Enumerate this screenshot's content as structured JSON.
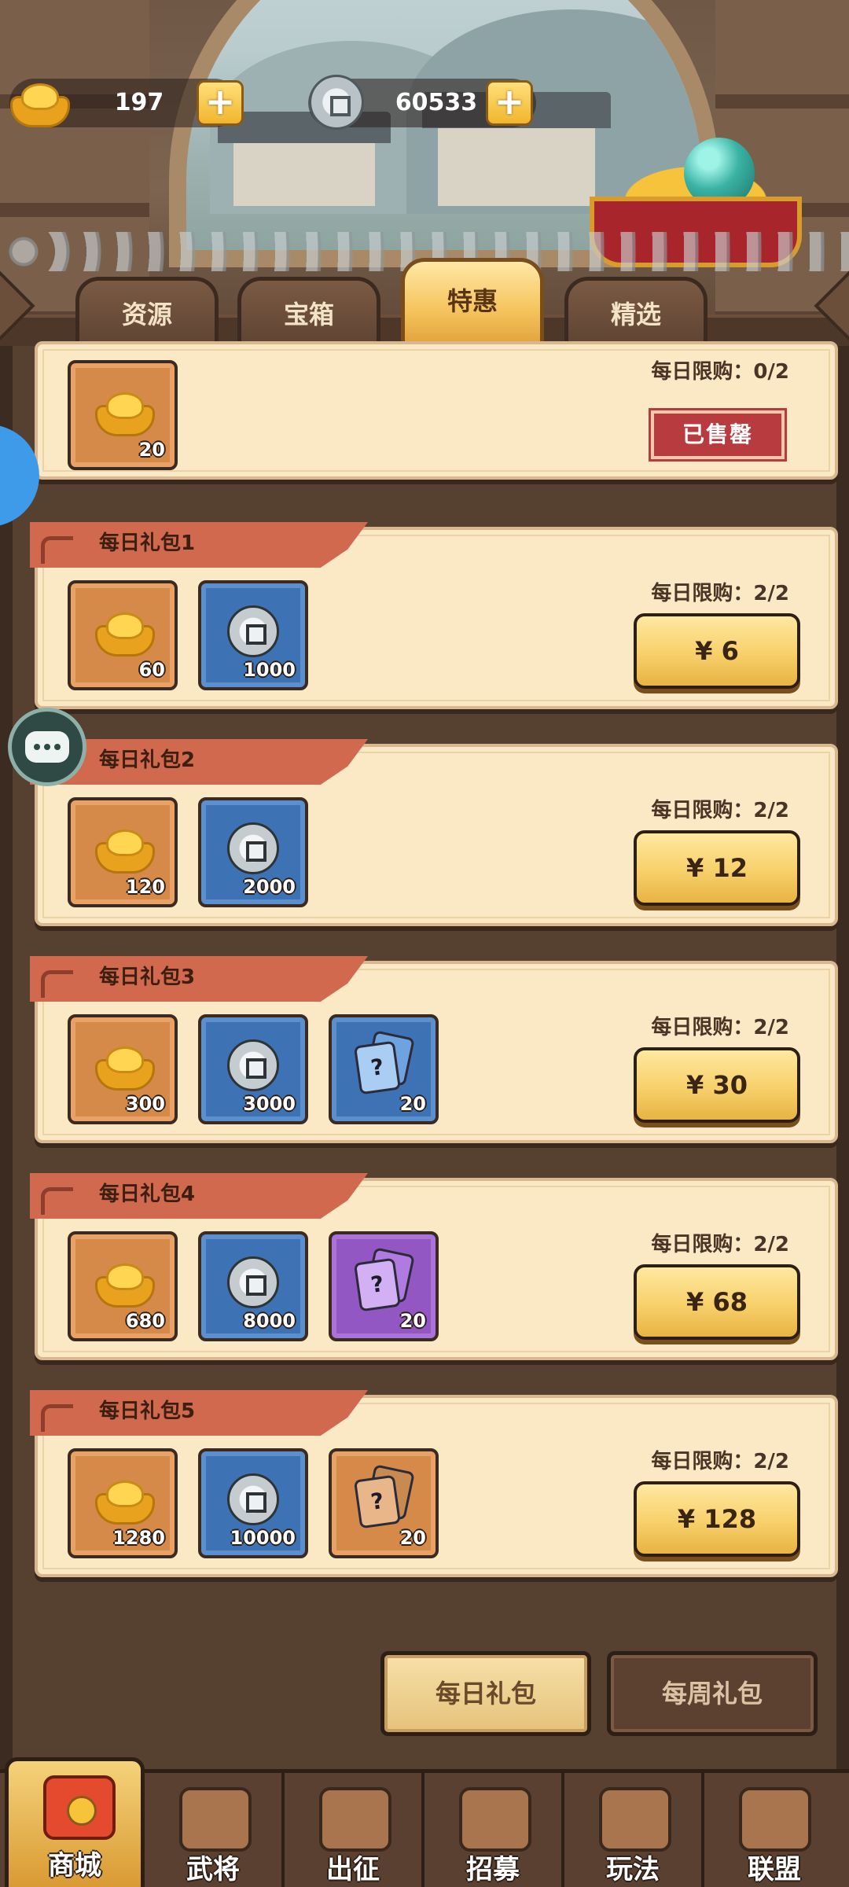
{
  "currency": {
    "gold": {
      "icon": "gold-ingot-icon",
      "value": "197"
    },
    "silver": {
      "icon": "silver-coin-icon",
      "value": "60533"
    }
  },
  "tabs": [
    {
      "label": "资源"
    },
    {
      "label": "宝箱"
    },
    {
      "label": "特惠",
      "active": true
    },
    {
      "label": "精选"
    }
  ],
  "top_card": {
    "items": [
      {
        "icon": "gold-ingot-icon",
        "qty": "20"
      }
    ],
    "limit": "每日限购：0/2",
    "status": "已售罄"
  },
  "packs": [
    {
      "title": "每日礼包1",
      "items": [
        {
          "icon": "gold-ingot-icon",
          "qty": "60"
        },
        {
          "icon": "silver-coin-icon",
          "qty": "1000"
        }
      ],
      "limit": "每日限购：2/2",
      "price": "¥ 6"
    },
    {
      "title": "每日礼包2",
      "items": [
        {
          "icon": "gold-ingot-icon",
          "qty": "120"
        },
        {
          "icon": "silver-coin-icon",
          "qty": "2000"
        }
      ],
      "limit": "每日限购：2/2",
      "price": "¥ 12"
    },
    {
      "title": "每日礼包3",
      "items": [
        {
          "icon": "gold-ingot-icon",
          "qty": "300"
        },
        {
          "icon": "silver-coin-icon",
          "qty": "3000"
        },
        {
          "icon": "blue-card-icon",
          "qty": "20",
          "mark": "?"
        }
      ],
      "limit": "每日限购：2/2",
      "price": "¥ 30"
    },
    {
      "title": "每日礼包4",
      "items": [
        {
          "icon": "gold-ingot-icon",
          "qty": "680"
        },
        {
          "icon": "silver-coin-icon",
          "qty": "8000"
        },
        {
          "icon": "purple-card-icon",
          "qty": "20",
          "mark": "?"
        }
      ],
      "limit": "每日限购：2/2",
      "price": "¥ 68"
    },
    {
      "title": "每日礼包5",
      "items": [
        {
          "icon": "gold-ingot-icon",
          "qty": "1280"
        },
        {
          "icon": "silver-coin-icon",
          "qty": "10000"
        },
        {
          "icon": "bronze-card-icon",
          "qty": "20",
          "mark": "?"
        }
      ],
      "limit": "每日限购：2/2",
      "price": "¥ 128"
    }
  ],
  "sub_tabs": [
    {
      "label": "每日礼包",
      "active": true
    },
    {
      "label": "每周礼包"
    }
  ],
  "bottom_nav": [
    {
      "label": "商城",
      "icon": "shop-chest-icon",
      "active": true
    },
    {
      "label": "武将",
      "icon": "helmet-icon"
    },
    {
      "label": "出征",
      "icon": "general-face-icon"
    },
    {
      "label": "招募",
      "icon": "scroll-icon"
    },
    {
      "label": "玩法",
      "icon": "pavilion-icon"
    },
    {
      "label": "联盟",
      "icon": "banner-icon"
    }
  ],
  "floating": {
    "chat": {
      "icon": "chat-bubble-icon"
    }
  }
}
